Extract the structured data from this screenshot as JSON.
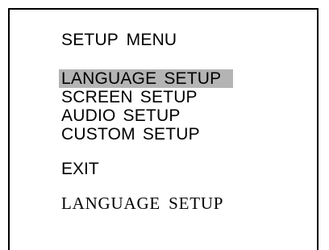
{
  "menu": {
    "title": "SETUP MENU",
    "items": [
      {
        "label": "LANGUAGE SETUP",
        "selected": true
      },
      {
        "label": "SCREEN SETUP",
        "selected": false
      },
      {
        "label": "AUDIO SETUP",
        "selected": false
      },
      {
        "label": "CUSTOM SETUP",
        "selected": false
      }
    ],
    "exit_label": "EXIT",
    "status_text": "LANGUAGE SETUP"
  },
  "colors": {
    "background": "#ffffff",
    "text": "#000000",
    "highlight": "#b4b4b4"
  }
}
